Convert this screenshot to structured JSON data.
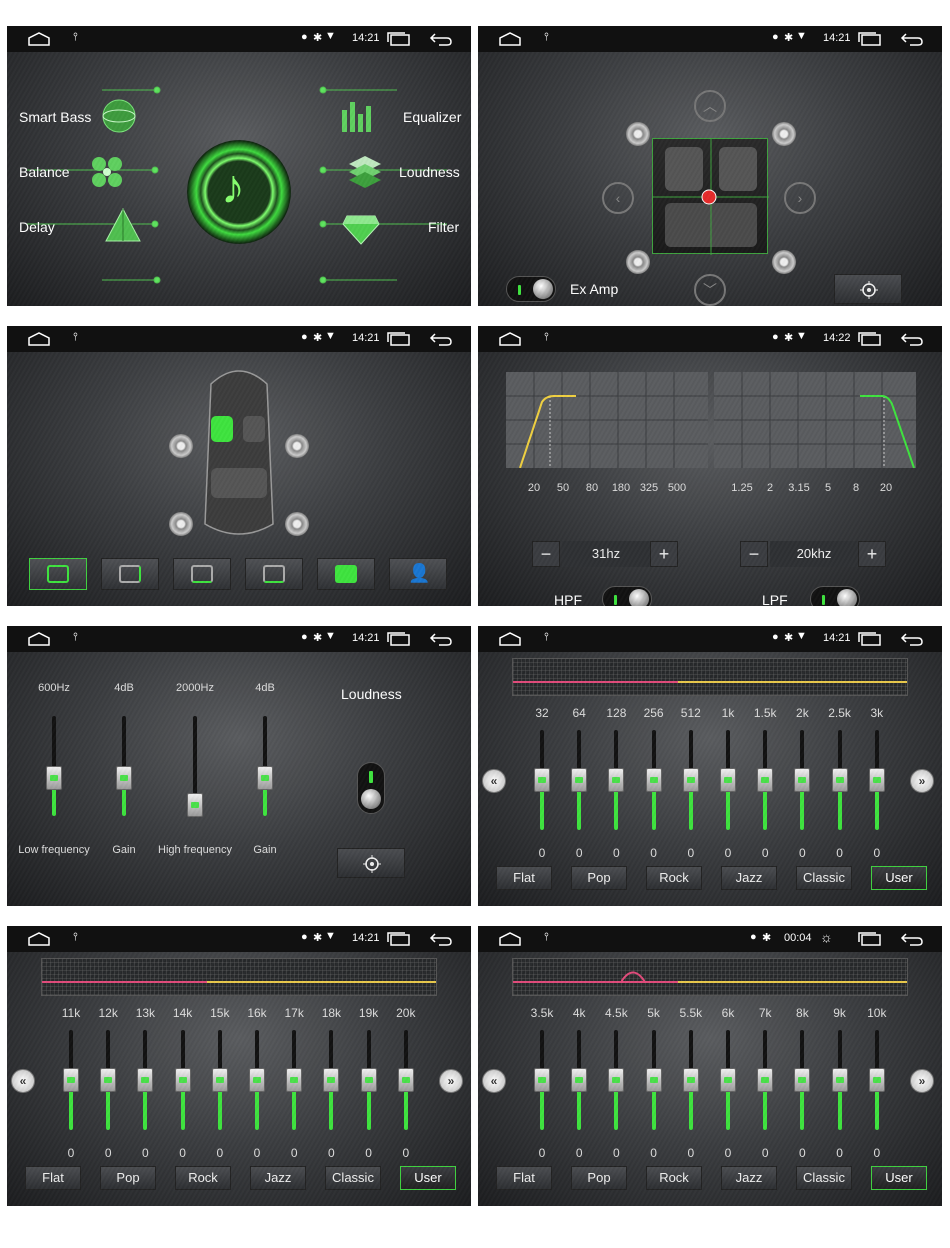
{
  "statusbar": {
    "time_1": "14:21",
    "time_2": "14:22",
    "time_3": "00:04"
  },
  "panel1": {
    "smart_bass": "Smart Bass",
    "balance": "Balance",
    "delay": "Delay",
    "equalizer": "Equalizer",
    "loudness": "Loudness",
    "filter": "Filter"
  },
  "panel2": {
    "ex_amp": "Ex Amp"
  },
  "panel4": {
    "hpf_ticks": [
      "20",
      "50",
      "80",
      "180",
      "325",
      "500"
    ],
    "lpf_ticks": [
      "1.25",
      "2",
      "3.15",
      "5",
      "8",
      "20"
    ],
    "hpf_value": "31hz",
    "lpf_value": "20khz",
    "hpf_label": "HPF",
    "lpf_label": "LPF",
    "minus": "−",
    "plus": "+"
  },
  "panel5": {
    "sliders": [
      {
        "top": "600Hz",
        "bottom": "Low frequency",
        "level": 0.4
      },
      {
        "top": "4dB",
        "bottom": "Gain",
        "level": 0.4
      },
      {
        "top": "2000Hz",
        "bottom": "High frequency",
        "level": 0.1
      },
      {
        "top": "4dB",
        "bottom": "Gain",
        "level": 0.4
      }
    ],
    "loudness": "Loudness"
  },
  "eq_presets": [
    "Flat",
    "Pop",
    "Rock",
    "Jazz",
    "Classic",
    "User"
  ],
  "eq_pages": [
    {
      "bands": [
        "32",
        "64",
        "128",
        "256",
        "512",
        "1k",
        "1.5k",
        "2k",
        "2.5k",
        "3k"
      ],
      "values": [
        "0",
        "0",
        "0",
        "0",
        "0",
        "0",
        "0",
        "0",
        "0",
        "0"
      ]
    },
    {
      "bands": [
        "11k",
        "12k",
        "13k",
        "14k",
        "15k",
        "16k",
        "17k",
        "18k",
        "19k",
        "20k"
      ],
      "values": [
        "0",
        "0",
        "0",
        "0",
        "0",
        "0",
        "0",
        "0",
        "0",
        "0"
      ]
    },
    {
      "bands": [
        "3.5k",
        "4k",
        "4.5k",
        "5k",
        "5.5k",
        "6k",
        "7k",
        "8k",
        "9k",
        "10k"
      ],
      "values": [
        "0",
        "0",
        "0",
        "0",
        "0",
        "0",
        "0",
        "0",
        "0",
        "0"
      ]
    }
  ],
  "colors": {
    "accent": "#3ee33e",
    "curve_pink": "#e04a7a",
    "curve_yellow": "#e8c84a"
  }
}
